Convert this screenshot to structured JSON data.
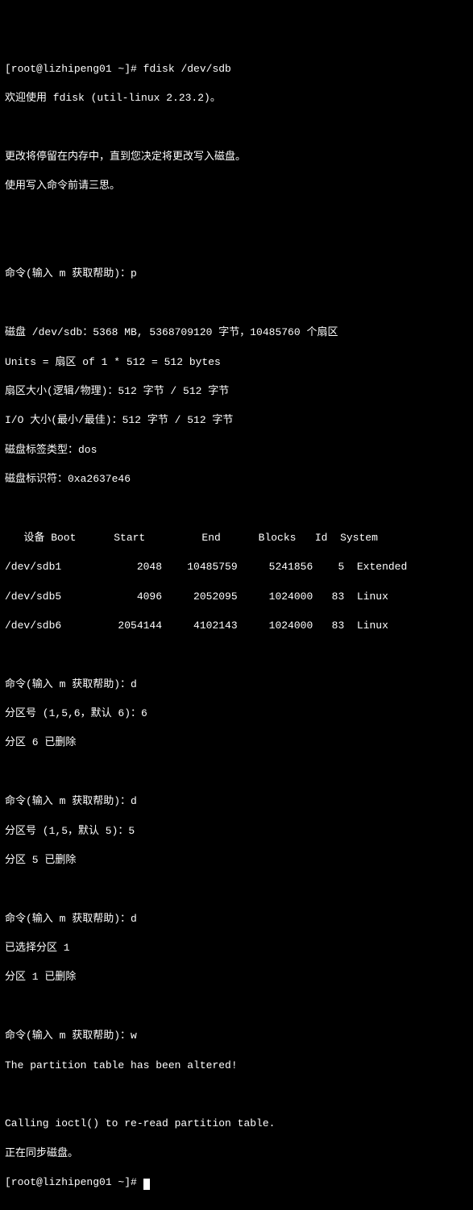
{
  "prompt1": "[root@lizhipeng01 ~]# ",
  "cmd1": "fdisk /dev/sdb",
  "welcome": "欢迎使用 fdisk (util-linux 2.23.2)。",
  "warn1": "更改将停留在内存中，直到您决定将更改写入磁盘。",
  "warn2": "使用写入命令前请三思。",
  "cmd_prompt": "命令(输入 m 获取帮助)：",
  "p_cmd": "p",
  "disk_info": "磁盘 /dev/sdb：5368 MB, 5368709120 字节，10485760 个扇区",
  "units": "Units = 扇区 of 1 * 512 = 512 bytes",
  "sector_size": "扇区大小(逻辑/物理)：512 字节 / 512 字节",
  "io_size": "I/O 大小(最小/最佳)：512 字节 / 512 字节",
  "label_type": "磁盘标签类型：dos",
  "disk_id": "磁盘标识符：0xa2637e46",
  "table_header": "   设备 Boot      Start         End      Blocks   Id  System",
  "row1": "/dev/sdb1            2048    10485759     5241856    5  Extended",
  "row2": "/dev/sdb5            4096     2052095     1024000   83  Linux",
  "row3": "/dev/sdb6         2054144     4102143     1024000   83  Linux",
  "d_cmd": "d",
  "part_prompt_156": "分区号 (1,5,6，默认 6)：",
  "part6": "6",
  "del6": "分区 6 已删除",
  "part_prompt_15": "分区号 (1,5，默认 5)：",
  "part5": "5",
  "del5": "分区 5 已删除",
  "selected1": "已选择分区 1",
  "del1": "分区 1 已删除",
  "w_cmd": "w",
  "altered": "The partition table has been altered!",
  "ioctl": "Calling ioctl() to re-read partition table.",
  "syncing": "正在同步磁盘。",
  "prompt2": "[root@lizhipeng01 ~]# "
}
